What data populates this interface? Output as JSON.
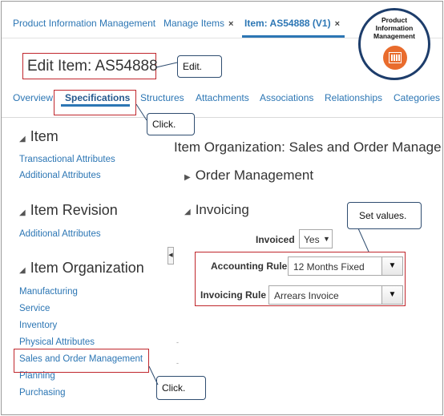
{
  "top_tabs": [
    {
      "label": "Product Information Management"
    },
    {
      "label": "Manage Items",
      "close": "×"
    },
    {
      "label": "Item: AS54888 (V1)",
      "close": "×"
    }
  ],
  "logo": {
    "line1": "Product",
    "line2": "Information",
    "line3": "Management"
  },
  "page_title": "Edit Item: AS54888",
  "callouts": {
    "edit": "Edit.",
    "click_tab": "Click.",
    "set_values": "Set values.",
    "click_link": "Click."
  },
  "sub_tabs": [
    "Overview",
    "Specifications",
    "Structures",
    "Attachments",
    "Associations",
    "Relationships",
    "Categories"
  ],
  "left_panel": {
    "item": {
      "heading": "Item",
      "links": [
        "Transactional Attributes",
        "Additional Attributes"
      ]
    },
    "item_revision": {
      "heading": "Item Revision",
      "links": [
        "Additional Attributes"
      ]
    },
    "item_organization": {
      "heading": "Item Organization",
      "links": [
        "Manufacturing",
        "Service",
        "Inventory",
        "Physical Attributes",
        "Sales and Order Management",
        "Planning",
        "Purchasing"
      ]
    }
  },
  "right_panel": {
    "title": "Item Organization: Sales and Order Manage",
    "order_management": "Order Management",
    "invoicing": "Invoicing",
    "invoiced_label": "Invoiced",
    "invoiced_value": "Yes",
    "accounting_rule_label": "Accounting Rule",
    "accounting_rule_value": "12 Months Fixed",
    "invoicing_rule_label": "Invoicing Rule",
    "invoicing_rule_value": "Arrears Invoice"
  },
  "icons": {
    "tab_close": "close-icon",
    "collapse": "triangle-down-icon",
    "expand": "triangle-right-icon",
    "dropdown": "chevron-down-icon",
    "splitter": "collapse-arrow-icon",
    "logo": "barcode-icon"
  },
  "colors": {
    "link": "#2c76b4",
    "callout_border": "#c0272d",
    "logo_accent": "#e96c2d",
    "logo_ring": "#1d3d6b"
  }
}
